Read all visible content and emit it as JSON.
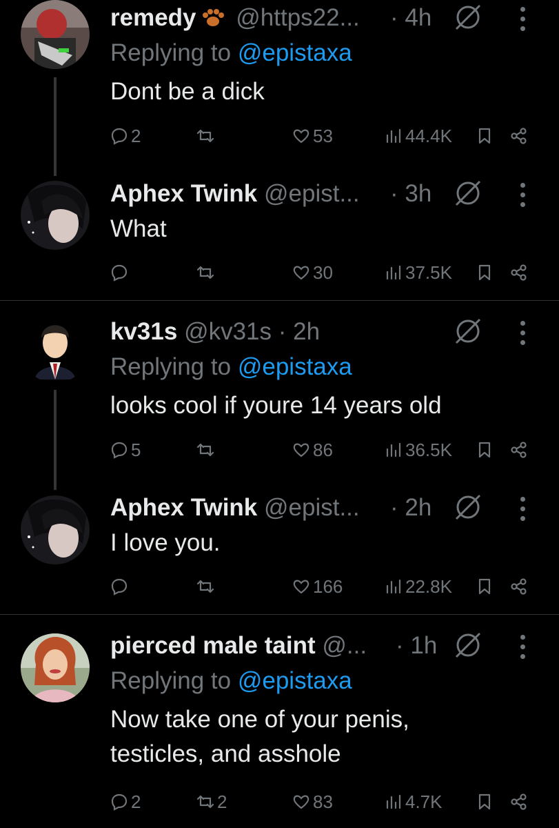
{
  "colors": {
    "background": "#000000",
    "text": "#e7e9ea",
    "muted": "#71767b",
    "accent": "#1d9bf0",
    "divider": "#2f3336"
  },
  "tweets": [
    {
      "name": "remedy",
      "has_paw_icon": true,
      "handle": "@https22...",
      "time": "· 4h",
      "replying_prefix": "Replying to ",
      "replying_to": "@epistaxa",
      "text_lines": [
        "Dont be a dick"
      ],
      "replies": "2",
      "retweets": "",
      "likes": "53",
      "views": "44.4K"
    },
    {
      "name": "Aphex Twink",
      "handle": "@epist...",
      "time": "· 3h",
      "text_lines": [
        "What"
      ],
      "replies": "",
      "retweets": "",
      "likes": "30",
      "views": "37.5K"
    },
    {
      "name": "kv31s",
      "handle": "@kv31s",
      "time": "· 2h",
      "replying_prefix": "Replying to ",
      "replying_to": "@epistaxa",
      "text_lines": [
        "looks cool if youre 14 years old"
      ],
      "replies": "5",
      "retweets": "",
      "likes": "86",
      "views": "36.5K"
    },
    {
      "name": "Aphex Twink",
      "handle": "@epist...",
      "time": "· 2h",
      "text_lines": [
        "I love you."
      ],
      "replies": "",
      "retweets": "",
      "likes": "166",
      "views": "22.8K"
    },
    {
      "name": "pierced male taint",
      "handle": "@...",
      "time": "· 1h",
      "replying_prefix": "Replying to ",
      "replying_to": "@epistaxa",
      "text_lines": [
        "Now take one of your penis,",
        "testicles, and asshole"
      ],
      "replies": "2",
      "retweets": "2",
      "likes": "83",
      "views": "4.7K"
    }
  ]
}
